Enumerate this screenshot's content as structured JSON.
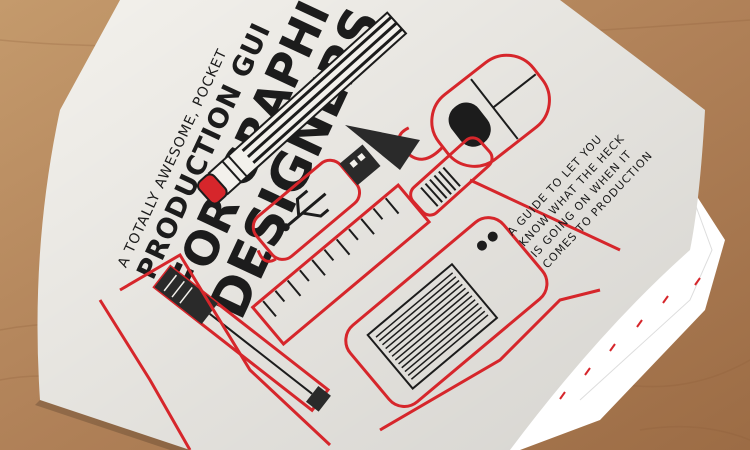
{
  "booklet": {
    "tagline": "A TOTALLY AWESOME, POCKET",
    "title_line1": "PRODUCTION GUI",
    "title_line2": "FOR GRAPHI",
    "title_line3": "DESIGNERS",
    "subtitle_line1": "A GUIDE TO LET YOU",
    "subtitle_line2": "KNOW WHAT THE HECK",
    "subtitle_line3": "IS GOING ON WHEN IT",
    "subtitle_line4": "COMES TO PRODUCTION"
  },
  "colors": {
    "accent_red": "#d6262b",
    "ink": "#1c1c1c",
    "paper": "#f3f1ec",
    "wood": "#b88a5e"
  },
  "icons": [
    "pencil-icon",
    "computer-mouse-icon",
    "craft-knife-icon",
    "usb-drive-icon",
    "ruler-icon",
    "printer-icon",
    "pen-icon"
  ]
}
